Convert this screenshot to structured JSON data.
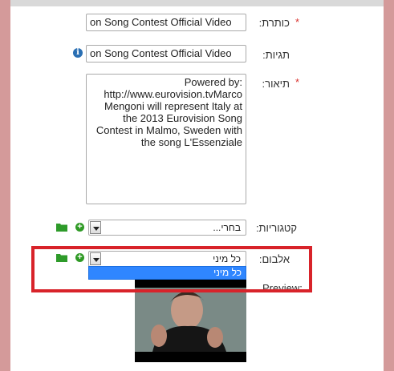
{
  "form": {
    "title_label": "כותרת:",
    "title_value": "on Song Contest Official Video",
    "tags_label": "תגיות:",
    "tags_value": "on Song Contest Official Video",
    "description_label": "תיאור:",
    "description_value": "Powered by:\nhttp://www.eurovision.tvMarco\nMengoni will represent Italy at\nthe 2013 Eurovision Song\nContest in Malmo, Sweden with\nthe song L'Essenziale",
    "categories_label": "קטגוריות:",
    "categories_value": "בחרי...",
    "album_label": "אלבום:",
    "album_value": "כל מיני",
    "album_option_selected": "כל מיני",
    "preview_label": "Preview:",
    "required_mark": "*"
  },
  "icons": {
    "folder": "folder-icon",
    "add": "plus-circle-icon",
    "info": "info-icon"
  },
  "colors": {
    "page_background": "#d49a9a",
    "highlight": "#d8232a",
    "dropdown_selected": "#2f86ff",
    "add_icon": "#2f9a25",
    "info_icon": "#2a6fb3"
  }
}
